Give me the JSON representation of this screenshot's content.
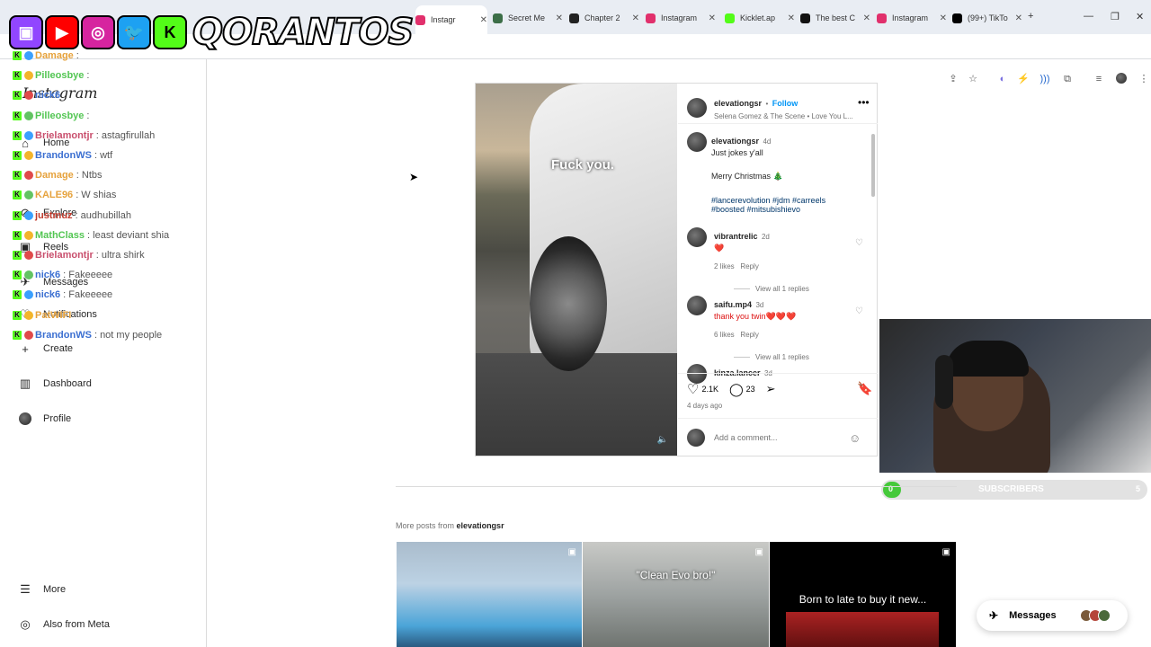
{
  "browser": {
    "tabs": [
      {
        "label": "Instagr",
        "active": true,
        "color": "#e1306c"
      },
      {
        "label": "Secret Me",
        "active": false,
        "color": "#3c6e47"
      },
      {
        "label": "Chapter 2",
        "active": false,
        "color": "#222222"
      },
      {
        "label": "Instagram",
        "active": false,
        "color": "#e1306c"
      },
      {
        "label": "Kicklet.ap",
        "active": false,
        "color": "#53fc18"
      },
      {
        "label": "The best C",
        "active": false,
        "color": "#111111"
      },
      {
        "label": "Instagram",
        "active": false,
        "color": "#e1306c"
      },
      {
        "label": "(99+) TikTo",
        "active": false,
        "color": "#000000"
      }
    ],
    "new_tab_label": "+"
  },
  "overlay": {
    "channel_name": "QORANTOS",
    "badge_colors": [
      "#9146ff",
      "#ff0000",
      "#d6249f",
      "#1da1f2",
      "#53fc18"
    ],
    "chat": [
      {
        "user": "Damage",
        "msg": ":",
        "color": "#e6a23c"
      },
      {
        "user": "Pilleosbye",
        "msg": ":",
        "color": "#53c653"
      },
      {
        "user": "nick6",
        "msg": "",
        "color": "#3b6fd1"
      },
      {
        "user": "Pilleosbye",
        "msg": ":",
        "color": "#53c653"
      },
      {
        "user": "Brielamontjr",
        "msg": ": astagfirullah",
        "color": "#c94f6d"
      },
      {
        "user": "BrandonWS",
        "msg": ": wtf",
        "color": "#3b6fd1"
      },
      {
        "user": "Damage",
        "msg": ": Ntbs",
        "color": "#e6a23c"
      },
      {
        "user": "KALE96",
        "msg": ": W shias",
        "color": "#e6a23c"
      },
      {
        "user": "justmuz",
        "msg": ": audhubillah",
        "color": "#c0392b"
      },
      {
        "user": "MathClass",
        "msg": ": least deviant shia",
        "color": "#53c653"
      },
      {
        "user": "Brielamontjr",
        "msg": ": ultra shirk",
        "color": "#c94f6d"
      },
      {
        "user": "nick6",
        "msg": ": Fakeeeee",
        "color": "#3b6fd1"
      },
      {
        "user": "nick6",
        "msg": ": Fakeeeee",
        "color": "#3b6fd1"
      },
      {
        "user": "PatWIFI",
        "msg": "",
        "color": "#e6a23c"
      },
      {
        "user": "BrandonWS",
        "msg": ": not my people",
        "color": "#3b6fd1"
      }
    ]
  },
  "sidebar": {
    "logo": "Instagram",
    "items": [
      {
        "label": "Home",
        "icon": "home-icon",
        "glyph": "⌂"
      },
      {
        "label": "Explore",
        "icon": "compass-icon",
        "glyph": "⊘"
      },
      {
        "label": "Reels",
        "icon": "reels-icon",
        "glyph": "▣"
      },
      {
        "label": "Messages",
        "icon": "messages-icon",
        "glyph": "✈"
      },
      {
        "label": "Notifications",
        "icon": "heart-icon",
        "glyph": "♡"
      },
      {
        "label": "Create",
        "icon": "plus-icon",
        "glyph": "+"
      },
      {
        "label": "Dashboard",
        "icon": "dashboard-icon",
        "glyph": "▥"
      },
      {
        "label": "Profile",
        "icon": "profile-avatar",
        "glyph": ""
      }
    ],
    "more": "More",
    "also_from_meta": "Also from Meta"
  },
  "post": {
    "author": "elevationgsr",
    "follow": "Follow",
    "audio": "Selena Gomez & The Scene • Love You L...",
    "caption_user": "elevationgsr",
    "caption_time": "4d",
    "caption": "Just jokes y'all",
    "caption2": "Merry Christmas",
    "tags_line1": "#lancerevolution #jdm #carreels",
    "tags_line2": "#boosted #mitsubishievo",
    "video_caption": "Fuck you.",
    "comments": [
      {
        "user": "vibrantrelic",
        "time": "2d",
        "text": "❤️",
        "likes": "2 likes",
        "reply": "Reply",
        "view_replies": "View all 1 replies"
      },
      {
        "user": "saifu.mp4",
        "time": "3d",
        "text": "thank you twin❤️❤️❤️",
        "likes": "6 likes",
        "reply": "Reply",
        "view_replies": "View all 1 replies"
      },
      {
        "user": "kinza.lancer",
        "time": "3d",
        "text": ""
      }
    ],
    "likes": "2.1K",
    "comment_count": "23",
    "posted": "4 days ago",
    "add_comment_placeholder": "Add a comment..."
  },
  "subscribers": {
    "label": "SUBSCRIBERS",
    "current": "0",
    "goal": "5",
    "progress": 0.0
  },
  "more_posts": {
    "prefix": "More posts from",
    "user": "elevationgsr",
    "thumbs": [
      {
        "caption": ""
      },
      {
        "caption": "\"Clean Evo bro!\""
      },
      {
        "caption": "Born to late to buy it new..."
      }
    ]
  },
  "messages_button": {
    "label": "Messages"
  }
}
